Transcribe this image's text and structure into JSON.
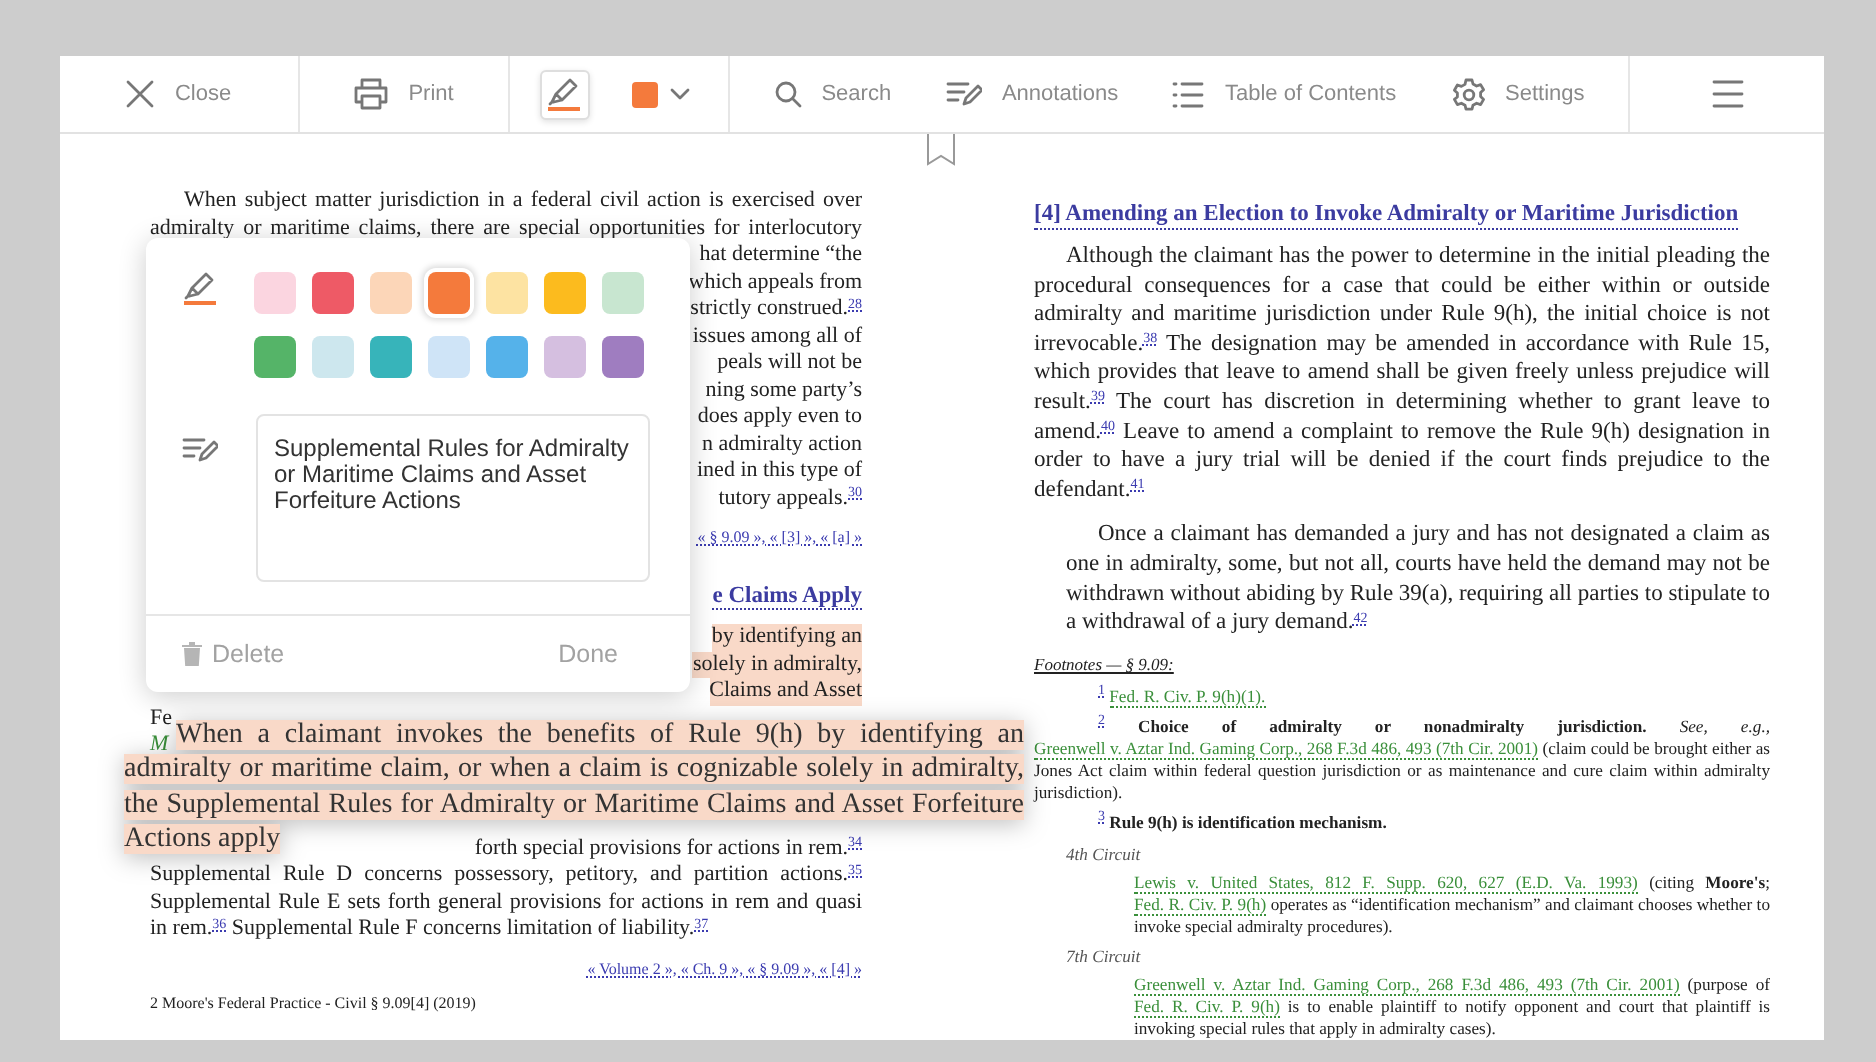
{
  "toolbar": {
    "groups": [
      [
        {
          "kind": "close",
          "label": "Close"
        }
      ],
      [
        {
          "kind": "print",
          "label": "Print"
        }
      ],
      [
        {
          "kind": "highlighter",
          "selected": true
        },
        {
          "kind": "color",
          "color": "#f47a3c"
        }
      ],
      [
        {
          "kind": "search",
          "label": "Search"
        },
        {
          "kind": "annotations",
          "label": "Annotations"
        },
        {
          "kind": "toc",
          "label": "Table of Contents"
        },
        {
          "kind": "settings",
          "label": "Settings"
        }
      ],
      [
        {
          "kind": "menu"
        }
      ]
    ]
  },
  "left_page": {
    "lines": [
      {
        "text": "When subject matter jurisdiction in a federal civil action is exercised over",
        "kind": "first",
        "cut_start": false,
        "cut_end": false
      },
      {
        "text": "admiralty or maritime claims, there are special opportunities for interlocutory",
        "kind": "text",
        "cut_start": false,
        "cut_end": false
      },
      {
        "text": "hat determine “the",
        "kind": "text",
        "cut_start": true,
        "cut_end": false
      },
      {
        "text": "which appeals from",
        "kind": "text",
        "cut_start": true,
        "cut_end": false
      },
      {
        "text": "strictly construed.$^{28}$",
        "kind": "text",
        "cut_start": true,
        "cut_end": false
      },
      {
        "text": "issues among all of",
        "kind": "text",
        "cut_start": true,
        "cut_end": false
      },
      {
        "text": "peals will not be",
        "kind": "text",
        "cut_start": true,
        "cut_end": false
      },
      {
        "text": "ning some party’s",
        "kind": "text",
        "cut_start": true,
        "cut_end": false
      },
      {
        "text": "does apply even to",
        "kind": "text",
        "cut_start": true,
        "cut_end": false
      },
      {
        "text": "n admiralty action",
        "kind": "text",
        "cut_start": true,
        "cut_end": false
      },
      {
        "text": "ined in this type of",
        "kind": "text",
        "cut_start": true,
        "cut_end": false
      },
      {
        "text": "tutory appeals.$^{30}$",
        "kind": "text",
        "cut_start": true,
        "cut_end": false
      },
      {
        "text": "« § 9.09 », « [3] », « [a] »",
        "kind": "links",
        "cut_start": true,
        "cut_end": false
      },
      {
        "text": "e Claims Apply",
        "kind": "heading",
        "cut_start": true,
        "cut_end": false
      },
      {
        "text": "by identifying an",
        "kind": "highlight",
        "cut_start": true,
        "cut_end": false
      },
      {
        "text": "solely in admiralty,",
        "kind": "highlight",
        "cut_start": true,
        "cut_end": false
      },
      {
        "text": "Claims and Asset",
        "kind": "highlight",
        "cut_start": true,
        "cut_end": false
      },
      {
        "text": "Fe",
        "kind": "text",
        "cut_start": false,
        "cut_end": true
      },
      {
        "text": "M",
        "kind": "marker",
        "cut_start": false,
        "cut_end": true
      }
    ],
    "lines_below": [
      {
        "text": "forth special provisions for actions in rem.$^{34}$",
        "kind": "text",
        "cut_start": true,
        "cut_end": false
      },
      {
        "text": "Supplemental Rule D concerns possessory, petitory, and partition actions.$^{35}$",
        "kind": "text",
        "cut_start": false,
        "cut_end": false
      },
      {
        "text": "Supplemental Rule E sets forth general provisions for actions in rem and quasi",
        "kind": "text",
        "cut_start": false,
        "cut_end": false
      },
      {
        "text": "in rem.$^{36}$ Supplemental Rule F concerns limitation of liability.$^{37}$",
        "kind": "text",
        "cut_start": false,
        "cut_end": true
      },
      {
        "text": "« Volume 2 », « Ch. 9 », « § 9.09 », « [4] »",
        "kind": "links",
        "cut_start": true,
        "cut_end": false
      },
      {
        "text": "2 Moore's Federal Practice - Civil § 9.09[4] (2019)",
        "kind": "source",
        "cut_start": false,
        "cut_end": true
      }
    ]
  },
  "annotation_popup": {
    "swatch_rows": [
      [
        {
          "color": "#fbd5e0",
          "selected": false
        },
        {
          "color": "#ee5a66",
          "selected": false
        },
        {
          "color": "#fcd6b8",
          "selected": false
        },
        {
          "color": "#f47a3c",
          "selected": true
        },
        {
          "color": "#fde3a2",
          "selected": false
        },
        {
          "color": "#fcbb1e",
          "selected": false
        },
        {
          "color": "#c8e6d0",
          "selected": false
        }
      ],
      [
        {
          "color": "#55b468",
          "selected": false
        },
        {
          "color": "#cde7ee",
          "selected": false
        },
        {
          "color": "#37b4ba",
          "selected": false
        },
        {
          "color": "#cfe4f7",
          "selected": false
        },
        {
          "color": "#55b2ea",
          "selected": false
        },
        {
          "color": "#d5bfe0",
          "selected": false
        },
        {
          "color": "#9f7dc0",
          "selected": false
        }
      ]
    ],
    "note": "Supplemental Rules for Admiralty or Maritime Claims and Asset Forfeiture Actions",
    "delete_label": "Delete",
    "done_label": "Done"
  },
  "highlight_preview": {
    "text": "When a claimant invokes the benefits of Rule 9(h) by identifying an admiralty or maritime claim, or when a claim is cognizable solely in admiralty, the Supplemental Rules for Admiralty or Maritime Claims and Asset Forfeiture Actions apply"
  },
  "right_page": {
    "heading": "[4]  Amending an Election to Invoke Admiralty or Maritime Jurisdiction",
    "paragraphs": [
      "Although the claimant has the power to determine in the initial pleading the procedural consequences for a case that could be either within or outside admiralty and maritime jurisdiction under Rule 9(h), the initial choice is not irrevocable.$^{38}$ The designation may be amended in accordance with Rule 15, which provides that leave to amend shall be given freely unless prejudice will result.$^{39}$ The court has discretion in determining whether to grant leave to amend.$^{40}$ Leave to amend a complaint to remove the Rule 9(h) designation in order to have a jury trial will be denied if the court finds prejudice to the defendant.$^{41}$",
      "Once a claimant has demanded a jury and has not designated a claim as one in admiralty, some, but not all, courts have held the demand may not be withdrawn without abiding by Rule 39(a), requiring all parties to stipulate to a withdrawal of a jury demand.$^{42}$"
    ],
    "footnotes_title": "Footnotes — § 9.09:",
    "footnotes": [
      {
        "kind": "note",
        "number": "1",
        "segments": [
          {
            "kind": "link",
            "text": "Fed. R. Civ. P. 9(h)(1)."
          }
        ]
      },
      {
        "kind": "note",
        "number": "2",
        "segments": [
          {
            "kind": "text",
            "text": "**Choice of admiralty or nonadmiralty jurisdiction.** *See, e.g.,*"
          },
          {
            "kind": "link",
            "text": "Greenwell v. Aztar Ind. Gaming Corp., 268 F.3d 486, 493 (7th Cir. 2001)"
          },
          {
            "kind": "text",
            "text": "(claim could be brought either as Jones Act claim within federal question jurisdiction or as maintenance and cure claim within admiralty jurisdiction)."
          }
        ]
      },
      {
        "kind": "note",
        "number": "3",
        "segments": [
          {
            "kind": "text",
            "text": "**Rule 9(h) is identification mechanism.**"
          }
        ]
      },
      {
        "kind": "circuit",
        "label": "4th Circuit",
        "segments": [
          {
            "kind": "link",
            "text": "Lewis v. United States, 812 F. Supp. 620, 627 (E.D. Va. 1993)"
          },
          {
            "kind": "text",
            "text": "(citing **Moore's**;"
          },
          {
            "kind": "link",
            "text": "Fed. R. Civ. P. 9(h)"
          },
          {
            "kind": "text",
            "text": "operates as “identification mechanism” and claimant chooses whether to invoke special admiralty procedures)."
          }
        ]
      },
      {
        "kind": "circuit",
        "label": "7th Circuit",
        "segments": [
          {
            "kind": "link",
            "text": "Greenwell v. Aztar Ind. Gaming Corp., 268 F.3d 486, 493 (7th Cir. 2001)"
          },
          {
            "kind": "text",
            "text": "(purpose of"
          },
          {
            "kind": "link",
            "text": "Fed. R. Civ. P. 9(h)"
          },
          {
            "kind": "text",
            "text": "is to enable plaintiff to notify opponent and court that plaintiff is invoking special rules that apply in admiralty cases)."
          }
        ]
      }
    ]
  }
}
